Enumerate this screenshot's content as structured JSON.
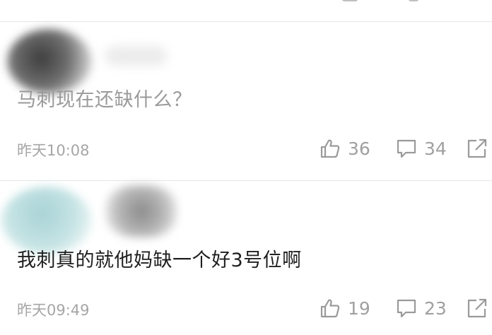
{
  "comments": [
    {
      "text": "马刺现在还缺什么？",
      "time": "昨天10:08",
      "likes": "36",
      "replies": "34"
    },
    {
      "text": "我刺真的就他妈缺一个好3号位啊",
      "time": "昨天09:49",
      "likes": "19",
      "replies": "23"
    }
  ],
  "icons": {
    "like": "thumbs-up-icon",
    "reply": "comment-icon",
    "share": "share-icon"
  },
  "colors": {
    "meta_text": "#a6a6a6",
    "icon": "#9a9a9a",
    "divider": "#e6e6e6"
  }
}
